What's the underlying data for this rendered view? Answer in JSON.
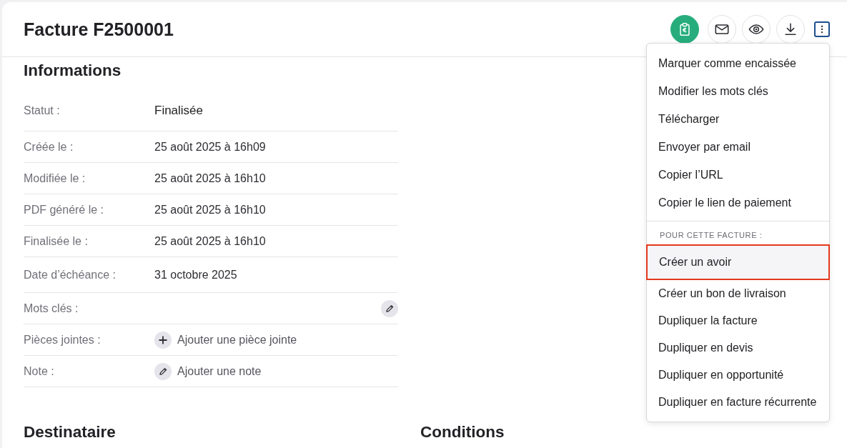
{
  "header": {
    "title": "Facture F2500001",
    "actions": [
      {
        "kind": "payment",
        "primary": true,
        "expanded": false
      },
      {
        "kind": "email",
        "primary": false,
        "expanded": false
      },
      {
        "kind": "preview",
        "primary": false,
        "expanded": false
      },
      {
        "kind": "download",
        "primary": false,
        "expanded": false
      },
      {
        "kind": "more",
        "primary": false,
        "expanded": true
      }
    ],
    "menu": {
      "groups": [
        {
          "items": [
            {
              "label": "Marquer comme encaissée",
              "highlighted": false
            },
            {
              "label": "Modifier les mots clés",
              "highlighted": false
            },
            {
              "label": "Télécharger",
              "highlighted": false
            },
            {
              "label": "Envoyer par email",
              "highlighted": false
            },
            {
              "label": "Copier l’URL",
              "highlighted": false
            },
            {
              "label": "Copier le lien de paiement",
              "highlighted": false
            }
          ]
        },
        {
          "label": "POUR CETTE FACTURE :",
          "items": [
            {
              "label": "Créer un avoir",
              "highlighted": true
            },
            {
              "label": "Créer un bon de livraison",
              "highlighted": false
            },
            {
              "label": "Dupliquer la facture",
              "highlighted": false
            },
            {
              "label": "Dupliquer en devis",
              "highlighted": false
            },
            {
              "label": "Dupliquer en opportunité",
              "highlighted": false
            },
            {
              "label": "Dupliquer en facture récurrente",
              "highlighted": false
            }
          ]
        }
      ]
    }
  },
  "informations": {
    "title": "Informations",
    "rows": [
      {
        "kind": "status",
        "label": "Statut :",
        "value": "Finalisée"
      },
      {
        "kind": "text",
        "label": "Créée le :",
        "value": "25 août 2025 à 16h09"
      },
      {
        "kind": "text",
        "label": "Modifiée le :",
        "value": "25 août 2025 à 16h10"
      },
      {
        "kind": "text",
        "label": "PDF généré le :",
        "value": "25 août 2025 à 16h10"
      },
      {
        "kind": "text",
        "label": "Finalisée le :",
        "value": "25 août 2025 à 16h10"
      },
      {
        "kind": "text",
        "label": "Date d’échéance :",
        "value": "31 octobre 2025"
      },
      {
        "kind": "edit",
        "label": "Mots clés :"
      },
      {
        "kind": "add",
        "label": "Pièces jointes :",
        "action": "Ajouter une pièce jointe"
      },
      {
        "kind": "note",
        "label": "Note :",
        "action": "Ajouter une note"
      }
    ]
  },
  "sections": [
    {
      "title": "Destinataire"
    },
    {
      "title": "Conditions"
    }
  ]
}
